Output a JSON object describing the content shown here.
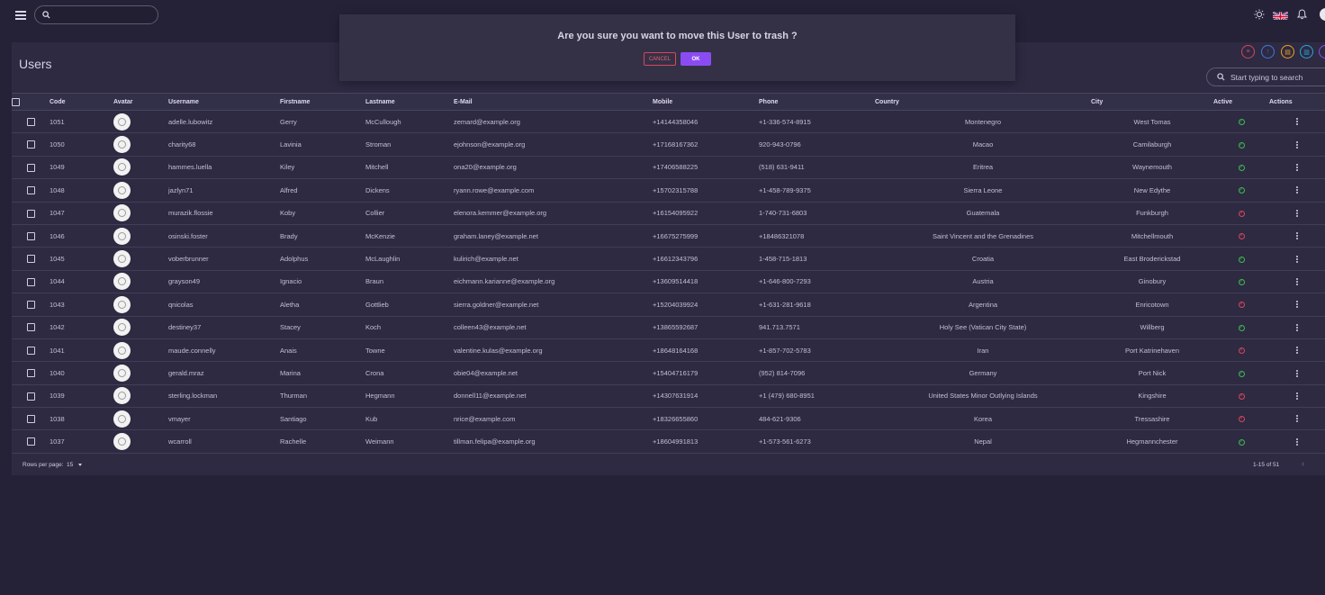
{
  "topbar": {
    "search_value": "",
    "flag": "uk-flag-icon"
  },
  "page": {
    "title": "Users",
    "search_placeholder": "Start typing to search"
  },
  "toolbar_actions": [
    {
      "icon": "list-icon",
      "color": "#d9455d"
    },
    {
      "icon": "upload-icon",
      "color": "#3f78e0"
    },
    {
      "icon": "file-icon",
      "color": "#f0a020"
    },
    {
      "icon": "document-icon",
      "color": "#2aa6d8"
    },
    {
      "icon": "more-icon",
      "color": "#8a4cf2"
    }
  ],
  "table": {
    "columns": [
      "Code",
      "Avatar",
      "Username",
      "Firstname",
      "Lastname",
      "E-Mail",
      "Mobile",
      "Phone",
      "Country",
      "City",
      "Active",
      "Actions"
    ],
    "rows": [
      {
        "code": "1051",
        "username": "adelle.lubowitz",
        "firstname": "Gerry",
        "lastname": "McCullough",
        "email": "zemard@example.org",
        "mobile": "+14144358046",
        "phone": "+1-336-574-8915",
        "country": "Montenegro",
        "city": "West Tomas",
        "active": true
      },
      {
        "code": "1050",
        "username": "charity68",
        "firstname": "Lavinia",
        "lastname": "Stroman",
        "email": "ejohnson@example.org",
        "mobile": "+17168167362",
        "phone": "920-943-0796",
        "country": "Macao",
        "city": "Camilaburgh",
        "active": true
      },
      {
        "code": "1049",
        "username": "hammes.luella",
        "firstname": "Kiley",
        "lastname": "Mitchell",
        "email": "ona20@example.org",
        "mobile": "+17406588225",
        "phone": "(518) 631-9411",
        "country": "Eritrea",
        "city": "Waynemouth",
        "active": true
      },
      {
        "code": "1048",
        "username": "jazlyn71",
        "firstname": "Alfred",
        "lastname": "Dickens",
        "email": "ryann.rowe@example.com",
        "mobile": "+15702315788",
        "phone": "+1-458-789-9375",
        "country": "Sierra Leone",
        "city": "New Edythe",
        "active": true
      },
      {
        "code": "1047",
        "username": "murazik.flossie",
        "firstname": "Koby",
        "lastname": "Collier",
        "email": "elenora.kemmer@example.org",
        "mobile": "+16154095922",
        "phone": "1-740-731-6803",
        "country": "Guatemala",
        "city": "Funkburgh",
        "active": false
      },
      {
        "code": "1046",
        "username": "osinski.foster",
        "firstname": "Brady",
        "lastname": "McKenzie",
        "email": "graham.laney@example.net",
        "mobile": "+16675275999",
        "phone": "+18486321078",
        "country": "Saint Vincent and the Grenadines",
        "city": "Mitchellmouth",
        "active": false
      },
      {
        "code": "1045",
        "username": "voberbrunner",
        "firstname": "Adolphus",
        "lastname": "McLaughlin",
        "email": "kulirich@example.net",
        "mobile": "+16612343796",
        "phone": "1-458-715-1813",
        "country": "Croatia",
        "city": "East Broderickstad",
        "active": true
      },
      {
        "code": "1044",
        "username": "grayson49",
        "firstname": "Ignacio",
        "lastname": "Braun",
        "email": "eichmann.karianne@example.org",
        "mobile": "+13609514418",
        "phone": "+1-646-800-7293",
        "country": "Austria",
        "city": "Ginobury",
        "active": true
      },
      {
        "code": "1043",
        "username": "qnicolas",
        "firstname": "Aletha",
        "lastname": "Gottlieb",
        "email": "sierra.goldner@example.net",
        "mobile": "+15204039924",
        "phone": "+1-631-281-9618",
        "country": "Argentina",
        "city": "Enricotown",
        "active": false
      },
      {
        "code": "1042",
        "username": "destiney37",
        "firstname": "Stacey",
        "lastname": "Koch",
        "email": "colleen43@example.net",
        "mobile": "+13865592687",
        "phone": "941.713.7571",
        "country": "Holy See (Vatican City State)",
        "city": "Willberg",
        "active": true
      },
      {
        "code": "1041",
        "username": "maude.connelly",
        "firstname": "Anais",
        "lastname": "Towne",
        "email": "valentine.kulas@example.org",
        "mobile": "+18648164168",
        "phone": "+1-857-702-5783",
        "country": "Iran",
        "city": "Port Katrinehaven",
        "active": false
      },
      {
        "code": "1040",
        "username": "gerald.mraz",
        "firstname": "Marina",
        "lastname": "Crona",
        "email": "obie04@example.net",
        "mobile": "+15404716179",
        "phone": "(952) 814-7096",
        "country": "Germany",
        "city": "Port Nick",
        "active": true
      },
      {
        "code": "1039",
        "username": "sterling.lockman",
        "firstname": "Thurman",
        "lastname": "Hegmann",
        "email": "donnell11@example.net",
        "mobile": "+14307631914",
        "phone": "+1 (479) 680-8951",
        "country": "United States Minor Outlying Islands",
        "city": "Kingshire",
        "active": false
      },
      {
        "code": "1038",
        "username": "vmayer",
        "firstname": "Santiago",
        "lastname": "Kub",
        "email": "nrice@example.com",
        "mobile": "+18326655860",
        "phone": "484-621-9306",
        "country": "Korea",
        "city": "Tressashire",
        "active": false
      },
      {
        "code": "1037",
        "username": "wcarroll",
        "firstname": "Rachelle",
        "lastname": "Weimann",
        "email": "tillman.felipa@example.org",
        "mobile": "+18604991813",
        "phone": "+1-573-561-6273",
        "country": "Nepal",
        "city": "Hegmannchester",
        "active": true
      }
    ]
  },
  "pagination": {
    "rows_per_page_label": "Rows per page:",
    "rows_per_page": "15",
    "range": "1-15 of 51"
  },
  "dialog": {
    "message": "Are you sure you want to move this User to trash ?",
    "cancel_label": "CANCEL",
    "ok_label": "OK"
  },
  "colors": {
    "active": "#3dbb4f",
    "inactive": "#d9455d",
    "accent": "#8a4cf2"
  }
}
